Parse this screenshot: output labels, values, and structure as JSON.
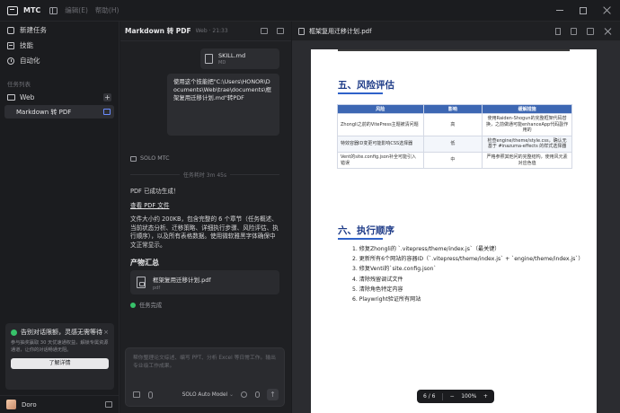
{
  "app": {
    "name": "MTC",
    "menus": [
      "编辑(E)",
      "帮助(H)"
    ]
  },
  "sidebar": {
    "nav": [
      {
        "label": "新建任务",
        "icon": "new-task-icon"
      },
      {
        "label": "技能",
        "icon": "skill-icon"
      },
      {
        "label": "自动化",
        "icon": "automation-icon"
      }
    ],
    "section_label": "任务列表",
    "folder": {
      "label": "Web",
      "add": "+"
    },
    "task": {
      "label": "Markdown 转 PDF"
    },
    "promo": {
      "title": "告别对话限额，灵感无需等待",
      "close": "×",
      "text": "参与抽奖赢取 30 天优速通权益，解锁专属资源通道，让你的对话畅通无阻。",
      "button": "了解详情"
    },
    "user": {
      "name": "Doro"
    }
  },
  "chat": {
    "title": "Markdown 转 PDF",
    "meta": "Web · 21:33",
    "file_chip": {
      "name": "SKILL.md",
      "ext": "MD"
    },
    "user_message": "使用这个技能把\"C:\\Users\\HONOR\\Documents\\Web\\trae\\documents\\框架复用迁移计划.md\"转PDF",
    "agent_name": "SOLO MTC",
    "elapsed": "任务耗时 3m 45s",
    "reply": {
      "line1": "PDF 已成功生成！",
      "link": "查看 PDF 文件",
      "summary": "文件大小约 200KB，包含完整的 6 个章节（任务概述、当前状态分析、迁移策略、详细执行步骤、风险评估、执行顺序），以及所有表格数据。使用微软雅黑字体确保中文正常显示。"
    },
    "artifacts_title": "产物汇总",
    "artifact": {
      "name": "框架复用迁移计划.pdf",
      "ext": "pdf"
    },
    "status": "任务完成",
    "composer": {
      "placeholder": "帮你整理论文综述、编写 PPT、分析 Excel 等日常工作。输出专业级工作成果。",
      "model": "SOLO Auto Model",
      "send": "↑"
    }
  },
  "preview": {
    "filename": "框架复用迁移计划.pdf",
    "pdf": {
      "section5_title": "五、风险评估",
      "table": {
        "headers": [
          "风险",
          "影响",
          "缓解措施"
        ],
        "rows": [
          [
            "Zhongli之前的VitePress主题被清问题",
            "高",
            "使用Raiden-Shogun的完整框架代码替换，之前做通可能enhanceApp代码副作用的"
          ],
          [
            "特效容器ID变更可能影响CSS选择器",
            "低",
            "检查engine/theme/style.css，确认无基于 #inazuma-effects 的样式选择器"
          ],
          [
            "Vent的site.config.json补全可能引入错误",
            "中",
            "严格参照其他问的完整结构，使用风元素对应色值"
          ]
        ]
      },
      "section6_title": "六、执行顺序",
      "steps": [
        "1. 修复Zhongli的 `.vitepress/theme/index.js`（最关键）",
        "2. 更新所有6个网站的容器ID（`.vitepress/theme/index.js` + `engine/theme/index.js`）",
        "3. 修复Venti的`site.config.json`",
        "4. 清除残留调试文件",
        "5. 清除角色特定内容",
        "6. Playwright验证所有网站"
      ]
    },
    "pager": {
      "page": "6 / 6",
      "zoom_out": "−",
      "zoom": "100%",
      "zoom_in": "+"
    }
  }
}
